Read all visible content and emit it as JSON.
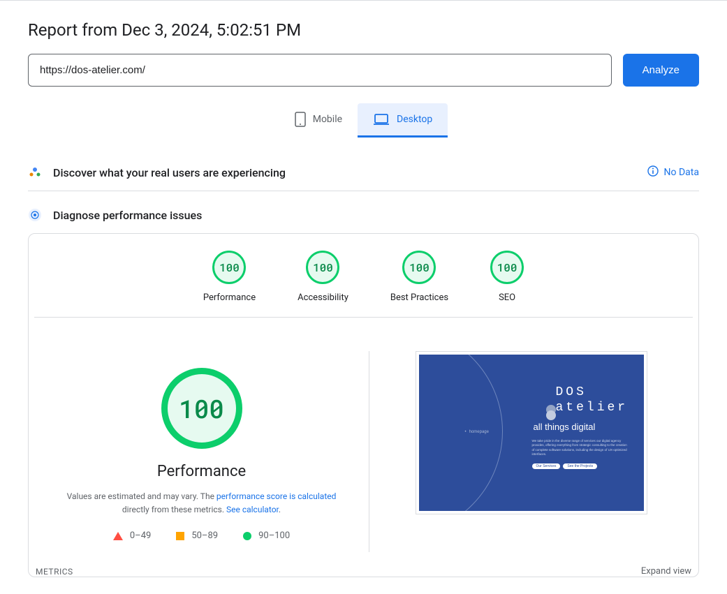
{
  "header": {
    "title": "Report from Dec 3, 2024, 5:02:51 PM",
    "url_value": "https://dos-atelier.com/",
    "analyze_label": "Analyze"
  },
  "tabs": {
    "mobile": "Mobile",
    "desktop": "Desktop"
  },
  "discover": {
    "title": "Discover what your real users are experiencing",
    "no_data": "No Data"
  },
  "diagnose": {
    "title": "Diagnose performance issues"
  },
  "scores": {
    "performance": {
      "value": "100",
      "label": "Performance"
    },
    "accessibility": {
      "value": "100",
      "label": "Accessibility"
    },
    "best_practices": {
      "value": "100",
      "label": "Best Practices"
    },
    "seo": {
      "value": "100",
      "label": "SEO"
    }
  },
  "perf_detail": {
    "big_score": "100",
    "heading": "Performance",
    "desc_prefix": "Values are estimated and may vary. The ",
    "desc_link1": "performance score is calculated",
    "desc_mid": " directly from these metrics. ",
    "desc_link2": "See calculator",
    "legend": {
      "red": "0–49",
      "orange": "50–89",
      "green": "90–100"
    }
  },
  "screenshot": {
    "brand1": "DOS",
    "brand2": "atelier",
    "tagline": "all things digital",
    "blurb": "We take pride in the diverse range of services our digital agency provides, offering everything from strategic consulting to the creation of complete software solutions, including the design of UX-optimized interfaces.",
    "btn1": "Our Services",
    "btn2": "See the Projects",
    "homepage": "homepage"
  },
  "metrics": {
    "label": "METRICS",
    "expand": "Expand view"
  }
}
